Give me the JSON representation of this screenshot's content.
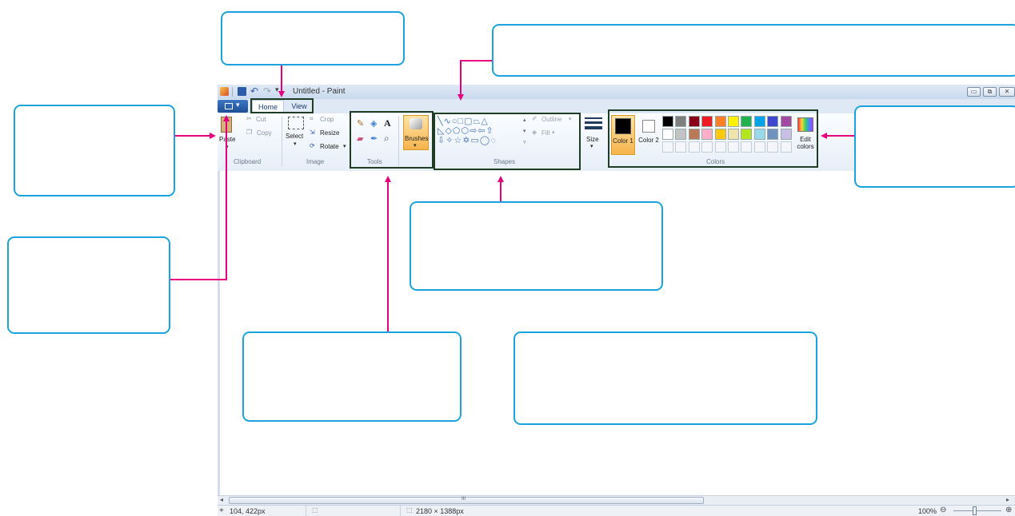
{
  "window": {
    "title": "Untitled - Paint"
  },
  "tabs": [
    {
      "label": "Home"
    },
    {
      "label": "View"
    }
  ],
  "clipboard": {
    "paste": "Paste",
    "cut": "Cut",
    "copy": "Copy",
    "group": "Clipboard"
  },
  "image": {
    "select": "Select",
    "crop": "Crop",
    "resize": "Resize",
    "rotate": "Rotate",
    "group": "Image"
  },
  "tools": {
    "group": "Tools",
    "text_tool": "A"
  },
  "brushes": {
    "label": "Brushes"
  },
  "shapes": {
    "outline": "Outline",
    "fill": "Fill",
    "group": "Shapes"
  },
  "size": {
    "label": "Size"
  },
  "colors": {
    "color1": "Color 1",
    "color2": "Color 2",
    "edit": "Edit colors",
    "group": "Colors",
    "color1_value": "#000000",
    "color2_value": "#ffffff",
    "palette_row1": [
      "#000000",
      "#7f7f7f",
      "#880015",
      "#ed1c24",
      "#ff7f27",
      "#fff200",
      "#22b14c",
      "#00a2e8",
      "#3f48cc",
      "#a349a4"
    ],
    "palette_row2": [
      "#ffffff",
      "#c3c3c3",
      "#b97a57",
      "#ffaec9",
      "#ffc90e",
      "#efe4b0",
      "#b5e61d",
      "#99d9ea",
      "#7092be",
      "#c8bfe7"
    ]
  },
  "scrollbar": {
    "grip": "III"
  },
  "status": {
    "position": "104, 422px",
    "dimensions": "2180 × 1388px",
    "zoom": "100%"
  },
  "accent": {
    "callout_border": "#1aa3dc",
    "arrow": "#e6007e",
    "highlight": "#1e3d24"
  }
}
